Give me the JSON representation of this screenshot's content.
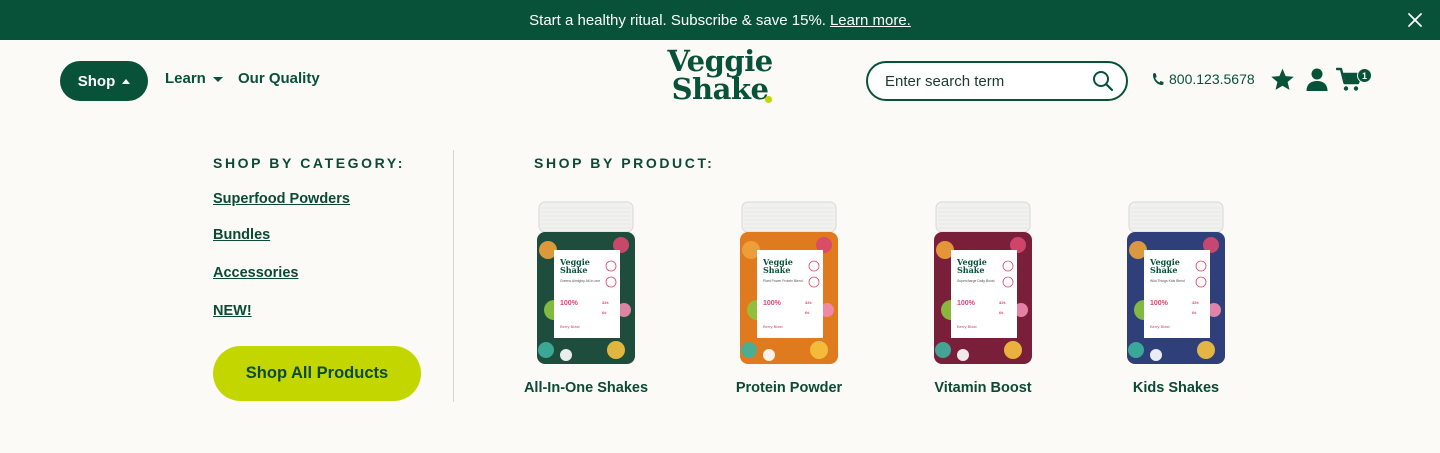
{
  "promo": {
    "text": "Start a healthy ritual. Subscribe & save 15%.",
    "link": "Learn more."
  },
  "nav": {
    "shop": "Shop",
    "learn": "Learn",
    "quality": "Our Quality"
  },
  "logo": {
    "line1": "Veggie",
    "line2": "Shake"
  },
  "search": {
    "placeholder": "Enter search term"
  },
  "phone": "800.123.5678",
  "cart_count": "1",
  "menu": {
    "category_title": "SHOP BY CATEGORY:",
    "categories": [
      "Superfood Powders",
      "Bundles",
      "Accessories",
      "NEW!"
    ],
    "shop_all": "Shop All Products",
    "product_title": "SHOP BY PRODUCT:",
    "products": [
      {
        "name": "All-In-One Shakes",
        "jar_sub": "Greens Almighty All-In-one",
        "flavor": "Berry Blast",
        "color": "#1f4d3d"
      },
      {
        "name": "Protein Powder",
        "jar_sub": "Plant Power Protein Blend",
        "flavor": "Berry Blast",
        "color": "#e07a1f"
      },
      {
        "name": "Vitamin Boost",
        "jar_sub": "Supercharge Daily Boost",
        "flavor": "Berry Blast",
        "color": "#7a1f3a"
      },
      {
        "name": "Kids Shakes",
        "jar_sub": "Wild Things Kids Blend",
        "flavor": "Berry Blast",
        "color": "#2f3f7a"
      }
    ]
  },
  "jar_label": {
    "line1": "Veggie",
    "line2": "Shake",
    "stat": "100%",
    "stat2": "32¢",
    "stat3": "6¢"
  },
  "colors": {
    "brand": "#08523a",
    "accent": "#c4d600",
    "background": "#fbfaf6"
  }
}
